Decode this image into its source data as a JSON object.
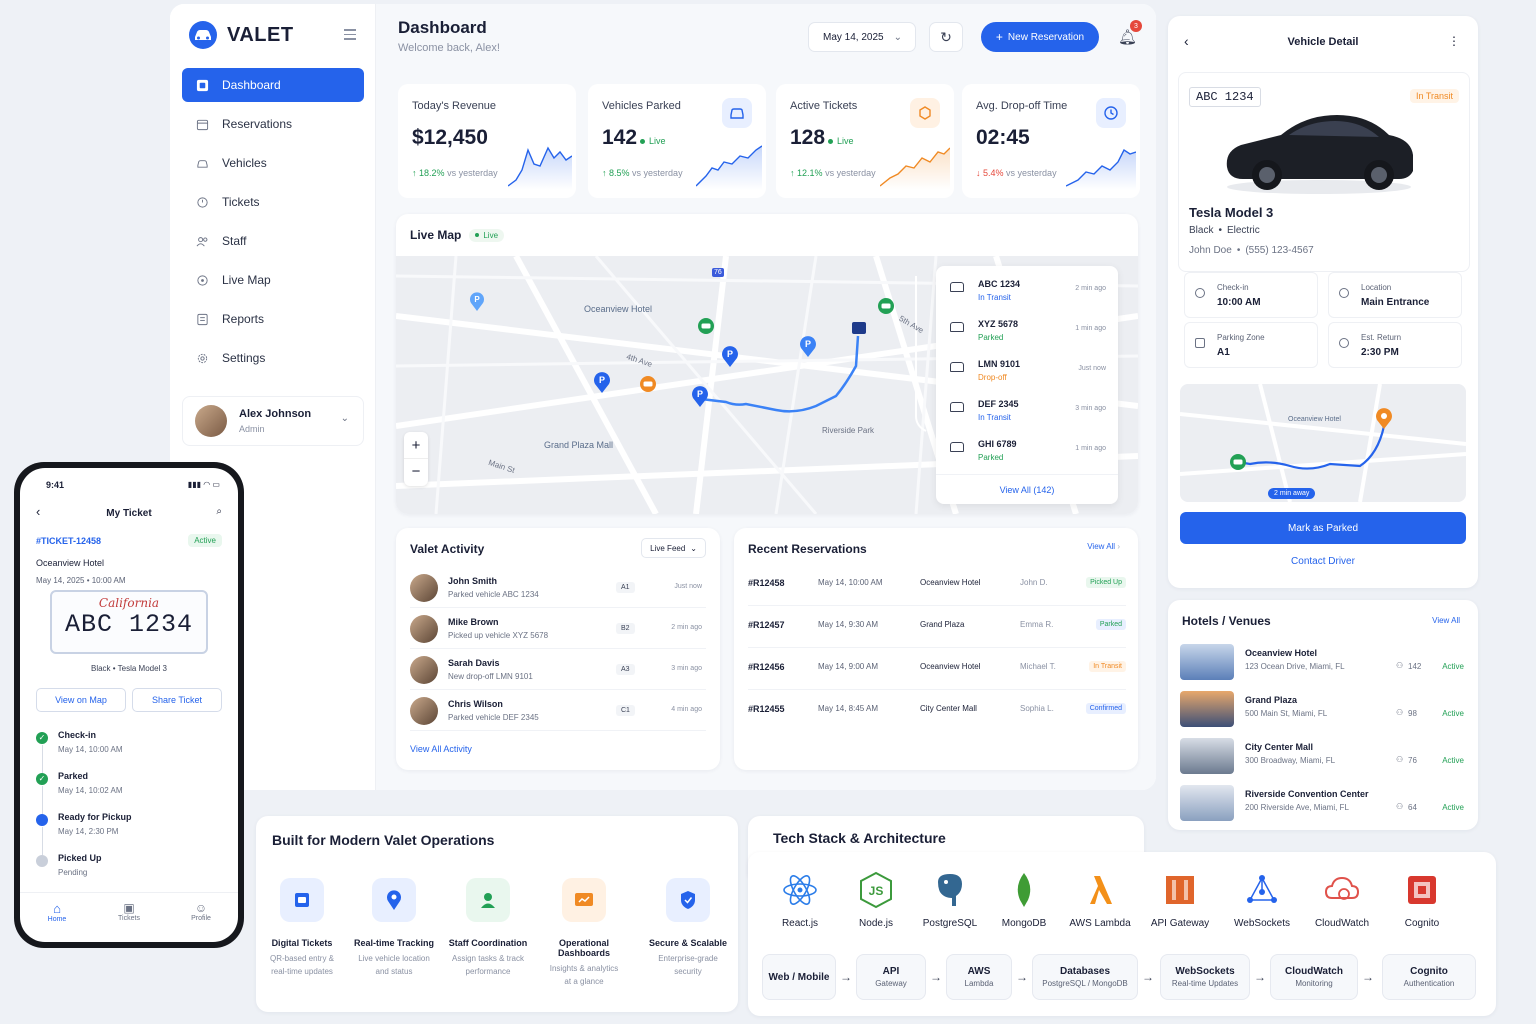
{
  "brand": {
    "name": "VALET"
  },
  "sidebar": {
    "items": [
      {
        "label": "Dashboard",
        "icon": "dashboard-icon"
      },
      {
        "label": "Reservations",
        "icon": "calendar-icon"
      },
      {
        "label": "Vehicles",
        "icon": "car-icon"
      },
      {
        "label": "Tickets",
        "icon": "ticket-icon"
      },
      {
        "label": "Staff",
        "icon": "staff-icon"
      },
      {
        "label": "Live Map",
        "icon": "map-icon"
      },
      {
        "label": "Reports",
        "icon": "reports-icon"
      },
      {
        "label": "Settings",
        "icon": "gear-icon"
      }
    ],
    "user": {
      "name": "Alex Johnson",
      "role": "Admin"
    }
  },
  "header": {
    "title": "Dashboard",
    "subtitle": "Welcome back, Alex!",
    "date": "May 14, 2025",
    "new_button": "New Reservation",
    "notif_count": "3"
  },
  "stats": [
    {
      "label": "Today's Revenue",
      "value": "$12,450",
      "change": "18.2%",
      "change_text": "vs yesterday",
      "dir": "up"
    },
    {
      "label": "Vehicles Parked",
      "value": "142",
      "live": "Live",
      "change": "8.5%",
      "change_text": "vs yesterday",
      "dir": "up"
    },
    {
      "label": "Active Tickets",
      "value": "128",
      "live": "Live",
      "change": "12.1%",
      "change_text": "vs yesterday",
      "dir": "up"
    },
    {
      "label": "Avg. Drop-off Time",
      "value": "02:45",
      "change": "5.4%",
      "change_text": "vs yesterday",
      "dir": "down"
    }
  ],
  "live_map": {
    "title": "Live Map",
    "badge": "Live",
    "labels": {
      "hotel": "Oceanview Hotel",
      "plaza": "Grand Plaza Mall",
      "park": "Riverside Park",
      "ave4": "4th Ave",
      "main": "Main St",
      "ave5": "5th Ave",
      "hwy": "76"
    },
    "zoom_in": "+",
    "zoom_out": "−",
    "vehicles": [
      {
        "plate": "ABC 1234",
        "status": "In Transit",
        "time": "2 min ago"
      },
      {
        "plate": "XYZ 5678",
        "status": "Parked",
        "time": "1 min ago"
      },
      {
        "plate": "LMN 9101",
        "status": "Drop-off",
        "time": "Just now"
      },
      {
        "plate": "DEF 2345",
        "status": "In Transit",
        "time": "3 min ago"
      },
      {
        "plate": "GHI 6789",
        "status": "Parked",
        "time": "1 min ago"
      }
    ],
    "view_all": "View All (142)"
  },
  "activity": {
    "title": "Valet Activity",
    "filter": "Live Feed",
    "view_all": "View All Activity",
    "items": [
      {
        "name": "John Smith",
        "desc": "Parked vehicle ABC 1234",
        "slot": "A1",
        "time": "Just now"
      },
      {
        "name": "Mike Brown",
        "desc": "Picked up vehicle XYZ 5678",
        "slot": "B2",
        "time": "2 min ago"
      },
      {
        "name": "Sarah Davis",
        "desc": "New drop-off LMN 9101",
        "slot": "A3",
        "time": "3 min ago"
      },
      {
        "name": "Chris Wilson",
        "desc": "Parked vehicle DEF 2345",
        "slot": "C1",
        "time": "4 min ago"
      }
    ]
  },
  "reservations": {
    "title": "Recent Reservations",
    "view_all": "View All",
    "rows": [
      {
        "id": "#R12458",
        "date": "May 14, 10:00 AM",
        "venue": "Oceanview Hotel",
        "guest": "John D.",
        "status": "Picked Up"
      },
      {
        "id": "#R12457",
        "date": "May 14, 9:30 AM",
        "venue": "Grand Plaza",
        "guest": "Emma R.",
        "status": "Parked"
      },
      {
        "id": "#R12456",
        "date": "May 14, 9:00 AM",
        "venue": "Oceanview Hotel",
        "guest": "Michael T.",
        "status": "In Transit"
      },
      {
        "id": "#R12455",
        "date": "May 14, 8:45 AM",
        "venue": "City Center Mall",
        "guest": "Sophia L.",
        "status": "Confirmed"
      }
    ]
  },
  "vehicle_detail": {
    "title": "Vehicle Detail",
    "plate": "ABC 1234",
    "status": "In Transit",
    "model": "Tesla Model 3",
    "color": "Black",
    "fuel": "Electric",
    "owner": "John Doe",
    "phone": "(555) 123-4567",
    "fields": [
      {
        "label": "Check-in",
        "value": "10:00 AM"
      },
      {
        "label": "Location",
        "value": "Main Entrance"
      },
      {
        "label": "Parking Zone",
        "value": "A1"
      },
      {
        "label": "Est. Return",
        "value": "2:30 PM"
      }
    ],
    "map_label": "Oceanview Hotel",
    "eta": "2 min away",
    "primary": "Mark as Parked",
    "secondary": "Contact Driver"
  },
  "hotels": {
    "title": "Hotels / Venues",
    "view_all": "View All",
    "items": [
      {
        "name": "Oceanview Hotel",
        "addr": "123 Ocean Drive, Miami, FL",
        "count": "142",
        "status": "Active"
      },
      {
        "name": "Grand Plaza",
        "addr": "500 Main St, Miami, FL",
        "count": "98",
        "status": "Active"
      },
      {
        "name": "City Center Mall",
        "addr": "300 Broadway, Miami, FL",
        "count": "76",
        "status": "Active"
      },
      {
        "name": "Riverside Convention Center",
        "addr": "200 Riverside Ave, Miami, FL",
        "count": "64",
        "status": "Active"
      }
    ]
  },
  "phone": {
    "time": "9:41",
    "title": "My Ticket",
    "ticket": "#TICKET-12458",
    "status": "Active",
    "venue": "Oceanview Hotel",
    "datetime": "May 14, 2025  •  10:00 AM",
    "plate_state": "California",
    "plate": "ABC 1234",
    "car": "Black   •   Tesla Model 3",
    "btn_map": "View on Map",
    "btn_share": "Share Ticket",
    "timeline": [
      {
        "title": "Check-in",
        "time": "May 14, 10:00 AM",
        "state": "done"
      },
      {
        "title": "Parked",
        "time": "May 14, 10:02 AM",
        "state": "done"
      },
      {
        "title": "Ready for Pickup",
        "time": "May 14, 2:30 PM",
        "state": "current"
      },
      {
        "title": "Picked Up",
        "time": "Pending",
        "state": "pending"
      }
    ],
    "tabs": [
      {
        "label": "Home"
      },
      {
        "label": "Tickets"
      },
      {
        "label": "Profile"
      }
    ]
  },
  "features": {
    "title": "Built for Modern Valet Operations",
    "items": [
      {
        "title": "Digital Tickets",
        "l1": "QR-based entry &",
        "l2": "real-time updates"
      },
      {
        "title": "Real-time Tracking",
        "l1": "Live vehicle location",
        "l2": "and status"
      },
      {
        "title": "Staff Coordination",
        "l1": "Assign tasks & track",
        "l2": "performance"
      },
      {
        "title": "Operational Dashboards",
        "l1": "Insights & analytics",
        "l2": "at a glance"
      },
      {
        "title": "Secure & Scalable",
        "l1": "Enterprise-grade",
        "l2": "security"
      }
    ]
  },
  "tech": {
    "title": "Tech Stack & Architecture",
    "items": [
      {
        "name": "React.js",
        "color": "#2b7de9"
      },
      {
        "name": "Node.js",
        "color": "#3c9a3c"
      },
      {
        "name": "PostgreSQL",
        "color": "#336791"
      },
      {
        "name": "MongoDB",
        "color": "#3f9c35"
      },
      {
        "name": "AWS Lambda",
        "color": "#f39019"
      },
      {
        "name": "API Gateway",
        "color": "#e0652b"
      },
      {
        "name": "WebSockets",
        "color": "#2563eb"
      },
      {
        "name": "CloudWatch",
        "color": "#e0524b"
      },
      {
        "name": "Cognito",
        "color": "#d8382e"
      }
    ],
    "arch": [
      {
        "title": "Web / Mobile",
        "sub": ""
      },
      {
        "title": "API",
        "sub": "Gateway"
      },
      {
        "title": "AWS",
        "sub": "Lambda"
      },
      {
        "title": "Databases",
        "sub": "PostgreSQL / MongoDB"
      },
      {
        "title": "WebSockets",
        "sub": "Real-time Updates"
      },
      {
        "title": "CloudWatch",
        "sub": "Monitoring"
      },
      {
        "title": "Cognito",
        "sub": "Authentication"
      }
    ]
  },
  "colors": {
    "accent": "#2563eb",
    "success": "#22a055",
    "danger": "#e5483b",
    "warning": "#f08a24"
  }
}
